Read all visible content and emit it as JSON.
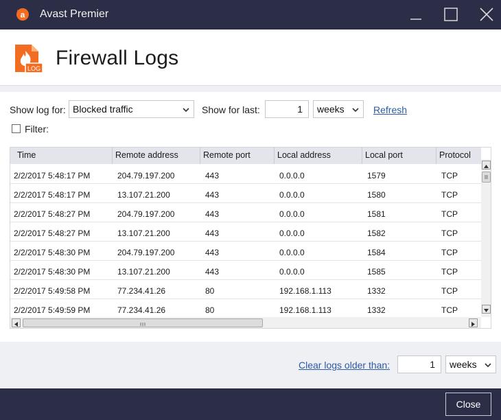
{
  "window": {
    "title": "Avast Premier"
  },
  "header": {
    "title": "Firewall Logs",
    "icon_badge": "LOG"
  },
  "filters": {
    "show_log_label": "Show log for:",
    "show_log_value": "Blocked traffic",
    "show_last_label": "Show for last:",
    "show_last_count": "1",
    "show_last_unit": "weeks",
    "refresh_label": "Refresh",
    "filter_label": "Filter:"
  },
  "table": {
    "columns": [
      "Time",
      "Remote address",
      "Remote port",
      "Local address",
      "Local port",
      "Protocol"
    ],
    "rows": [
      [
        "2/2/2017 5:48:17 PM",
        "204.79.197.200",
        "443",
        "0.0.0.0",
        "1579",
        "TCP"
      ],
      [
        "2/2/2017 5:48:17 PM",
        "13.107.21.200",
        "443",
        "0.0.0.0",
        "1580",
        "TCP"
      ],
      [
        "2/2/2017 5:48:27 PM",
        "204.79.197.200",
        "443",
        "0.0.0.0",
        "1581",
        "TCP"
      ],
      [
        "2/2/2017 5:48:27 PM",
        "13.107.21.200",
        "443",
        "0.0.0.0",
        "1582",
        "TCP"
      ],
      [
        "2/2/2017 5:48:30 PM",
        "204.79.197.200",
        "443",
        "0.0.0.0",
        "1584",
        "TCP"
      ],
      [
        "2/2/2017 5:48:30 PM",
        "13.107.21.200",
        "443",
        "0.0.0.0",
        "1585",
        "TCP"
      ],
      [
        "2/2/2017 5:49:58 PM",
        "77.234.41.26",
        "80",
        "192.168.1.113",
        "1332",
        "TCP"
      ],
      [
        "2/2/2017 5:49:59 PM",
        "77.234.41.26",
        "80",
        "192.168.1.113",
        "1332",
        "TCP"
      ]
    ]
  },
  "clear": {
    "label": "Clear logs older than:",
    "count": "1",
    "unit": "weeks"
  },
  "footer": {
    "close_label": "Close"
  },
  "colors": {
    "brand_orange": "#f26d21",
    "titlebar": "#2b2e46",
    "link": "#2b5aa7"
  }
}
